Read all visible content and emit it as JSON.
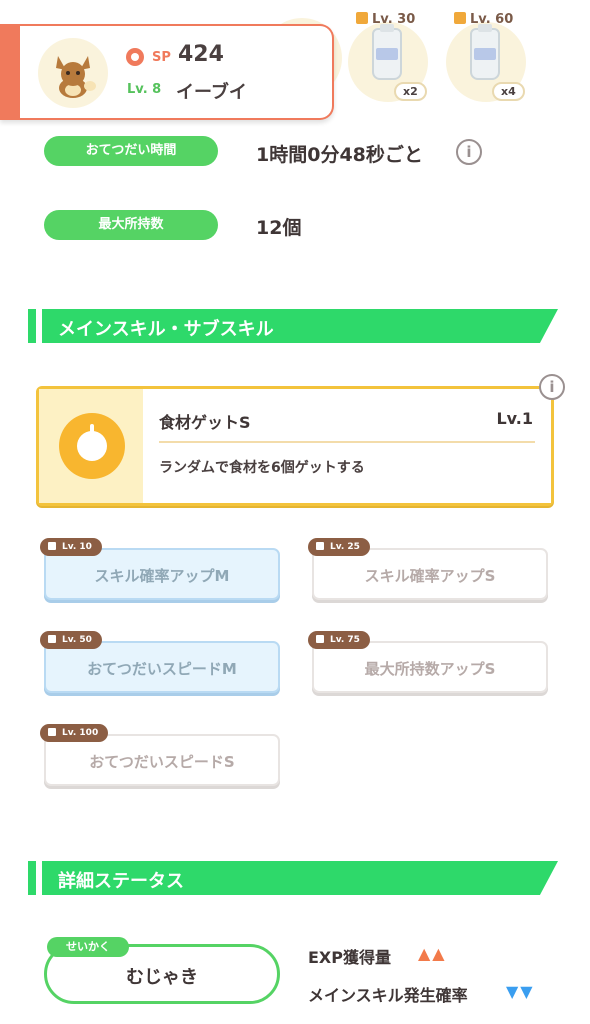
{
  "header": {
    "sp_label": "SP",
    "sp_value": "424",
    "level": "Lv. 8",
    "pokemon_name": "イーブイ"
  },
  "ingredient_slots": [
    {
      "level": "Lv. 30",
      "count": "x2"
    },
    {
      "level": "Lv. 60",
      "count": "x4"
    }
  ],
  "help": {
    "time_label": "おてつだい時間",
    "time_value": "1時間0分48秒ごと",
    "capacity_label": "最大所持数",
    "capacity_value": "12個"
  },
  "skills_section": {
    "title": "メインスキル・サブスキル"
  },
  "main_skill": {
    "name": "食材ゲットS",
    "level": "Lv.1",
    "description": "ランダムで食材を6個ゲットする"
  },
  "sub_skills": [
    {
      "level": "Lv. 10",
      "name": "スキル確率アップM",
      "style": "blue"
    },
    {
      "level": "Lv. 25",
      "name": "スキル確率アップS",
      "style": "white"
    },
    {
      "level": "Lv. 50",
      "name": "おてつだいスピードM",
      "style": "blue"
    },
    {
      "level": "Lv. 75",
      "name": "最大所持数アップS",
      "style": "white"
    },
    {
      "level": "Lv. 100",
      "name": "おてつだいスピードS",
      "style": "white"
    }
  ],
  "details_section": {
    "title": "詳細ステータス"
  },
  "nature": {
    "tag": "せいかく",
    "name": "むじゃき"
  },
  "stats": [
    {
      "label": "EXP獲得量",
      "arrows": "▲▲",
      "color": "#f27a4a"
    },
    {
      "label": "メインスキル発生確率",
      "arrows": "▼▼",
      "color": "#3a9ef0"
    }
  ],
  "colors": {
    "accent_green": "#2ed96a",
    "header_orange": "#f07a5c",
    "skill_gold": "#f3c33c"
  },
  "icons": {
    "info": "i"
  }
}
